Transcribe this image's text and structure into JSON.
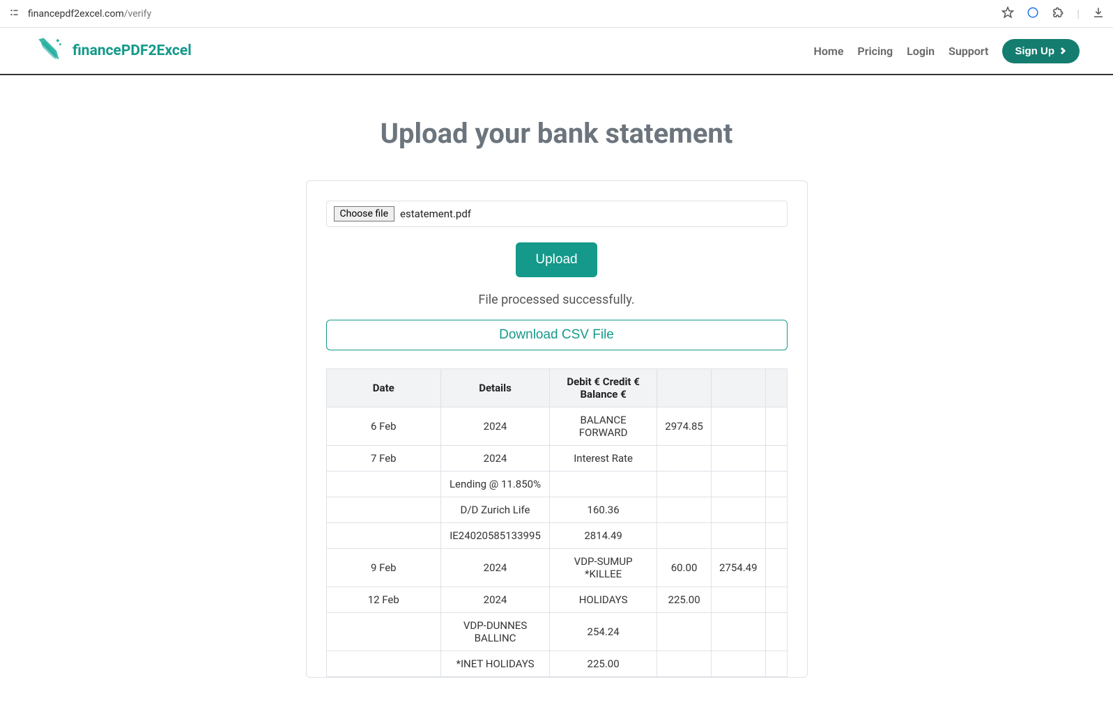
{
  "browser": {
    "url_host": "financepdf2excel.com",
    "url_path": "/verify"
  },
  "header": {
    "brand": "financePDF2Excel",
    "nav": [
      "Home",
      "Pricing",
      "Login",
      "Support"
    ],
    "signup": "Sign Up"
  },
  "page": {
    "title": "Upload your bank statement",
    "choose_file_label": "Choose file",
    "file_name": "estatement.pdf",
    "upload_label": "Upload",
    "status": "File processed successfully.",
    "download_label": "Download CSV File"
  },
  "table": {
    "headers": [
      "Date",
      "Details",
      "Debit € Credit € Balance €",
      "",
      "",
      ""
    ],
    "rows": [
      [
        "6 Feb",
        "2024",
        "BALANCE FORWARD",
        "2974.85",
        "",
        ""
      ],
      [
        "7 Feb",
        "2024",
        "Interest Rate",
        "",
        "",
        ""
      ],
      [
        "",
        "Lending @ 11.850%",
        "",
        "",
        "",
        ""
      ],
      [
        "",
        "D/D Zurich Life",
        "160.36",
        "",
        "",
        ""
      ],
      [
        "",
        "IE24020585133995",
        "2814.49",
        "",
        "",
        ""
      ],
      [
        "9 Feb",
        "2024",
        "VDP-SUMUP *KILLEE",
        "60.00",
        "2754.49",
        ""
      ],
      [
        "12 Feb",
        "2024",
        "HOLIDAYS",
        "225.00",
        "",
        ""
      ],
      [
        "",
        "VDP-DUNNES BALLINC",
        "254.24",
        "",
        "",
        ""
      ],
      [
        "",
        "*INET HOLIDAYS",
        "225.00",
        "",
        "",
        ""
      ]
    ]
  }
}
